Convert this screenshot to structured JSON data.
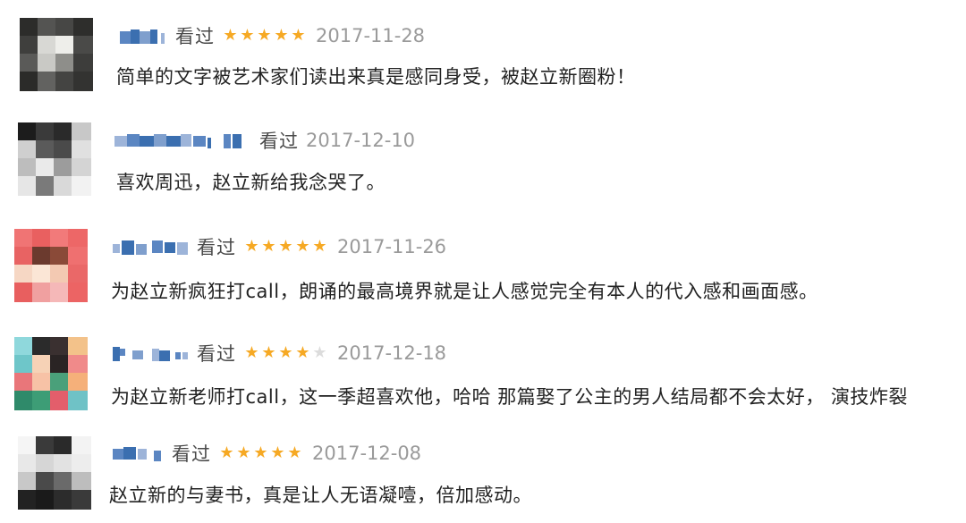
{
  "reviews": [
    {
      "status": "看过",
      "rating": 5,
      "date": "2017-11-28",
      "comment": "简单的文字被艺术家们读出来真是感同身受，被赵立新圈粉！",
      "avatar": "blurred-dark-avatar"
    },
    {
      "status": "看过",
      "rating": 0,
      "date": "2017-12-10",
      "comment": "喜欢周迅，赵立新给我念哭了。",
      "avatar": "blurred-face-avatar"
    },
    {
      "status": "看过",
      "rating": 5,
      "date": "2017-11-26",
      "comment": "为赵立新疯狂打call，朗诵的最高境界就是让人感觉完全有本人的代入感和画面感。",
      "avatar": "blurred-pink-avatar"
    },
    {
      "status": "看过",
      "rating": 4,
      "date": "2017-12-18",
      "comment": "为赵立新老师打call，这一季超喜欢他，哈哈 那篇娶了公主的男人结局都不会太好，  演技炸裂",
      "avatar": "blurred-cartoon-avatar"
    },
    {
      "status": "看过",
      "rating": 5,
      "date": "2017-12-08",
      "comment": "赵立新的与妻书，真是让人无语凝噎，倍加感动。",
      "avatar": "blurred-mask-avatar"
    }
  ],
  "colors": {
    "star_on": "#f6a924",
    "star_off": "#dcdcdc",
    "username_blur": "#3b6fb0"
  }
}
